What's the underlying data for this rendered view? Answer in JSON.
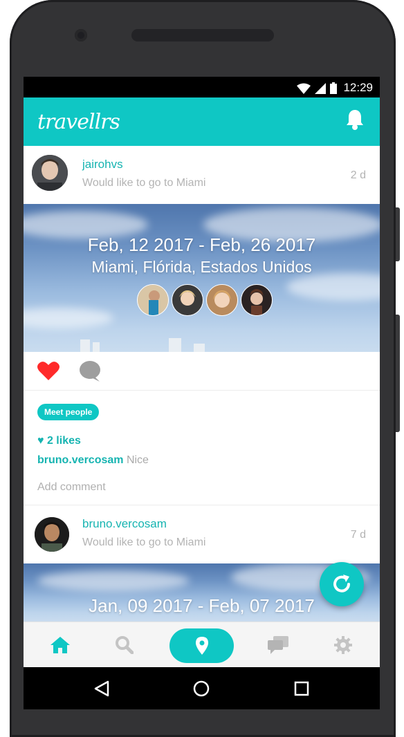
{
  "status_bar": {
    "time": "12:29"
  },
  "app": {
    "logo": "travellrs",
    "notification_icon": "bell-icon"
  },
  "posts": [
    {
      "username": "jairohvs",
      "wish": "Would like to go to Miami",
      "time_ago": "2 d",
      "dates": "Feb, 12 2017 - Feb, 26 2017",
      "place": "Miami, Flórida, Estados Unidos",
      "tag": "Meet people",
      "likes": "2 likes",
      "comment_user": "bruno.vercosam",
      "comment_text": "Nice",
      "add_comment": "Add comment"
    },
    {
      "username": "bruno.vercosam",
      "wish": "Would like to go to Miami",
      "time_ago": "7 d",
      "dates": "Jan, 09 2017 - Feb, 07 2017"
    }
  ],
  "colors": {
    "accent": "#0fc7c4",
    "accent_text": "#16b4b1",
    "heart": "#ff2a2a",
    "muted": "#b3b3b3"
  },
  "bottom_nav": [
    "home-icon",
    "search-icon",
    "location-pin-icon",
    "chat-icon",
    "gear-icon"
  ],
  "system_nav": [
    "back-icon",
    "home-circle-icon",
    "recents-icon"
  ]
}
